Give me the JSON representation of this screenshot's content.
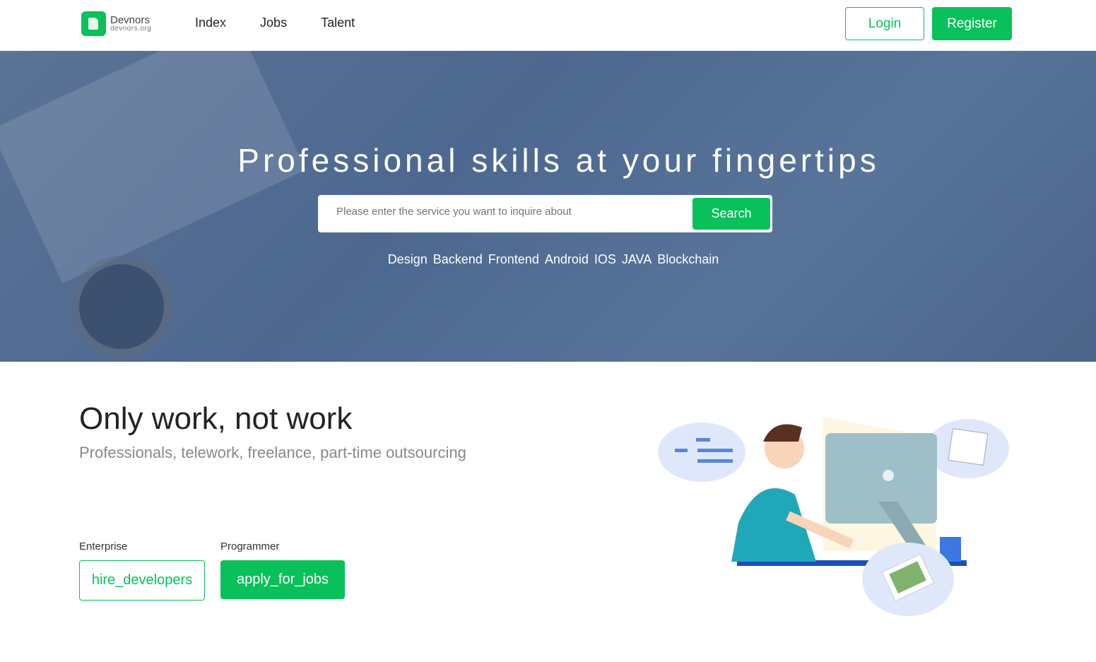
{
  "brand": {
    "name": "Devnors",
    "domain": "devnors.org",
    "color": "#0ac05a"
  },
  "nav": {
    "items": [
      "Index",
      "Jobs",
      "Talent"
    ],
    "login": "Login",
    "register": "Register"
  },
  "hero": {
    "title": "Professional skills at your fingertips",
    "search_placeholder": "Please enter the service you want to inquire about",
    "search_button": "Search",
    "tags": [
      "Design",
      "Backend",
      "Frontend",
      "Android",
      "IOS",
      "JAVA",
      "Blockchain"
    ]
  },
  "section": {
    "title": "Only work, not work",
    "subtitle": "Professionals, telework, freelance, part-time outsourcing",
    "enterprise_label": "Enterprise",
    "enterprise_button": "hire_developers",
    "programmer_label": "Programmer",
    "programmer_button": "apply_for_jobs"
  }
}
